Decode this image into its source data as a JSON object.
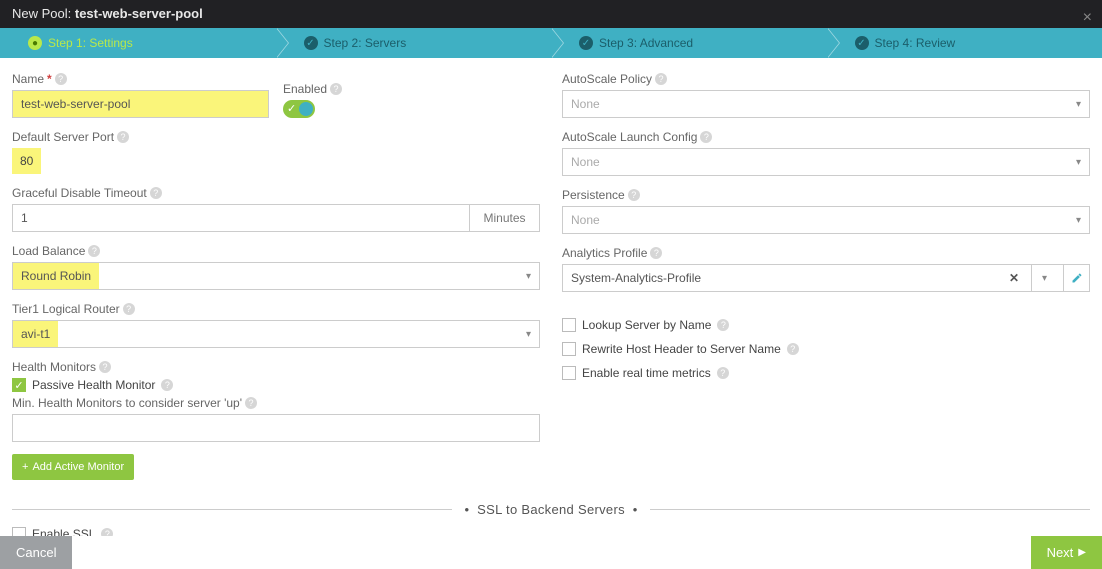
{
  "title": {
    "label": "New Pool:",
    "name": "test-web-server-pool"
  },
  "steps": [
    {
      "label": "Step 1: Settings",
      "active": true
    },
    {
      "label": "Step 2: Servers",
      "active": false
    },
    {
      "label": "Step 3: Advanced",
      "active": false
    },
    {
      "label": "Step 4: Review",
      "active": false
    }
  ],
  "left": {
    "name_label": "Name",
    "name_value": "test-web-server-pool",
    "enabled_label": "Enabled",
    "port_label": "Default Server Port",
    "port_value": "80",
    "timeout_label": "Graceful Disable Timeout",
    "timeout_value": "1",
    "timeout_unit": "Minutes",
    "lb_label": "Load Balance",
    "lb_value": "Round Robin",
    "tier1_label": "Tier1 Logical Router",
    "tier1_value": "avi-t1",
    "hm_label": "Health Monitors",
    "passive_label": "Passive Health Monitor",
    "min_hm_label": "Min. Health Monitors to consider server 'up'",
    "min_hm_value": "",
    "add_monitor_label": "Add Active Monitor"
  },
  "right": {
    "autoscale_policy_label": "AutoScale Policy",
    "autoscale_policy_value": "None",
    "autoscale_launch_label": "AutoScale Launch Config",
    "autoscale_launch_value": "None",
    "persistence_label": "Persistence",
    "persistence_value": "None",
    "analytics_label": "Analytics Profile",
    "analytics_value": "System-Analytics-Profile",
    "lookup_label": "Lookup Server by Name",
    "rewrite_label": "Rewrite Host Header to Server Name",
    "realtime_label": "Enable real time metrics"
  },
  "ssl_section_title": "SSL to Backend Servers",
  "enable_ssl_label": "Enable SSL",
  "footer": {
    "cancel": "Cancel",
    "next": "Next"
  }
}
